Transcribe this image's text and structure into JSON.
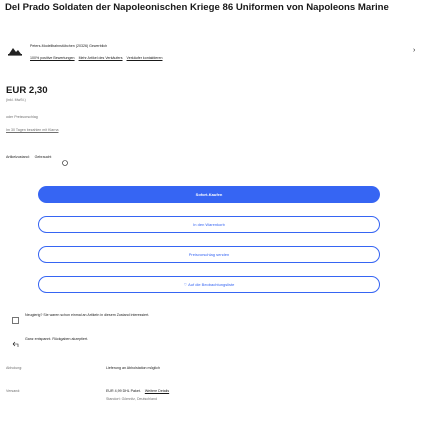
{
  "listing": {
    "title": "Del Prado Soldaten der Napoleonischen Kriege 86 Uniformen von Napoleons Marine",
    "seller_name": "Peters-Modellbahnstübchen (20326)  Gewerblich",
    "seller_links": [
      "100% positive Bewertungen",
      "Mehr Artikel des Verkäufers",
      "Verkäufer kontaktieren"
    ],
    "price": "EUR 2,30",
    "vat": "(inkl. MwSt.)",
    "best_offer": "oder Preisvorschlag",
    "best_offer_link": "Im 30 Tagen bezahlen mit Klarna",
    "condition_label": "Artikelzustand:",
    "condition_value": "Gebraucht",
    "buy_now": "Sofort-Kaufen",
    "add_to_cart": "In den Warenkorb",
    "make_offer": "Preisvorschlag senden",
    "watchlist": "♡ Auf die Beobachtungsliste",
    "popular_notice": "Neugierig? Sie waren schon einmal an Artikeln in diesem Zustand interessiert.",
    "returns_notice": "Ganz entspannt. Rückgaben akzeptiert.",
    "shipping_label": "Abholung:",
    "shipping_value": "Lieferung an Abholstation möglich",
    "delivery_label": "Versand:",
    "delivery_value": "EUR 4,99 DHL Paket.",
    "delivery_link": "Weitere Details",
    "delivery_location": "Standort: Gömnitz, Deutschland"
  }
}
